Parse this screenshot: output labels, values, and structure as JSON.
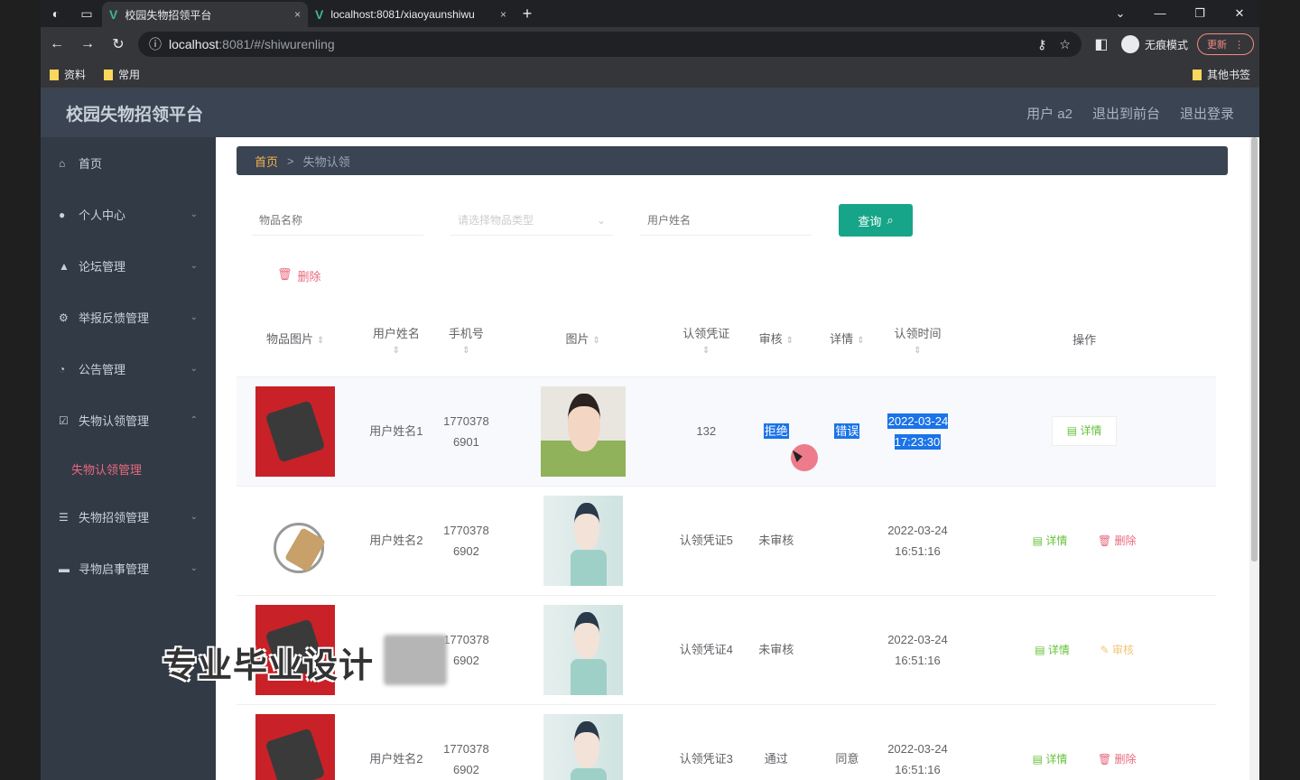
{
  "browser": {
    "tabs": [
      {
        "title": "校园失物招领平台",
        "close": "×",
        "active": true
      },
      {
        "title": "localhost:8081/xiaoyaunshiwu",
        "close": "×",
        "active": false
      }
    ],
    "new_tab": "+",
    "url_host": "localhost",
    "url_path": ":8081/#/shiwurenling",
    "incognito_label": "无痕模式",
    "update_label": "更新",
    "bookmarks": [
      "资料",
      "常用"
    ],
    "other_bookmarks": "其他书签"
  },
  "header": {
    "title": "校园失物招领平台",
    "links": [
      "用户 a2",
      "退出到前台",
      "退出登录"
    ]
  },
  "sidebar": {
    "items": [
      {
        "label": "首页",
        "icon": "home-icon"
      },
      {
        "label": "个人中心",
        "icon": "user-icon"
      },
      {
        "label": "论坛管理",
        "icon": "forum-icon"
      },
      {
        "label": "举报反馈管理",
        "icon": "feedback-icon"
      },
      {
        "label": "公告管理",
        "icon": "notice-icon"
      },
      {
        "label": "失物认领管理",
        "icon": "claim-icon"
      },
      {
        "label": "失物招领管理",
        "icon": "list-icon"
      },
      {
        "label": "寻物启事管理",
        "icon": "search-notice-icon"
      }
    ],
    "active_sub": "失物认领管理"
  },
  "breadcrumb": {
    "home": "首页",
    "sep": ">",
    "current": "失物认领"
  },
  "search": {
    "input1_placeholder": "物品名称",
    "select_placeholder": "请选择物品类型",
    "input2_placeholder": "用户姓名",
    "query_label": "查询"
  },
  "toolbar": {
    "delete_label": "删除"
  },
  "table": {
    "headers": [
      "物品图片",
      "用户姓名",
      "手机号",
      "图片",
      "认领凭证",
      "审核",
      "详情",
      "认领时间",
      "操作"
    ],
    "rows": [
      {
        "user": "用户姓名1",
        "phone": "17703786901",
        "voucher": "132",
        "audit": "拒绝",
        "detail": "错误",
        "time": "2022-03-24 17:23:30"
      },
      {
        "user": "用户姓名2",
        "phone": "17703786902",
        "voucher": "认领凭证5",
        "audit": "未审核",
        "detail": "",
        "time": "2022-03-24 16:51:16"
      },
      {
        "user": "",
        "phone": "17703786902",
        "voucher": "认领凭证4",
        "audit": "未审核",
        "detail": "",
        "time": "2022-03-24 16:51:16"
      },
      {
        "user": "用户姓名2",
        "phone": "17703786902",
        "voucher": "认领凭证3",
        "audit": "通过",
        "detail": "同意",
        "time": "2022-03-24 16:51:16"
      }
    ],
    "op_detail": "详情",
    "op_delete": "删除",
    "op_audit": "审核"
  },
  "watermark": "专业毕业设计"
}
